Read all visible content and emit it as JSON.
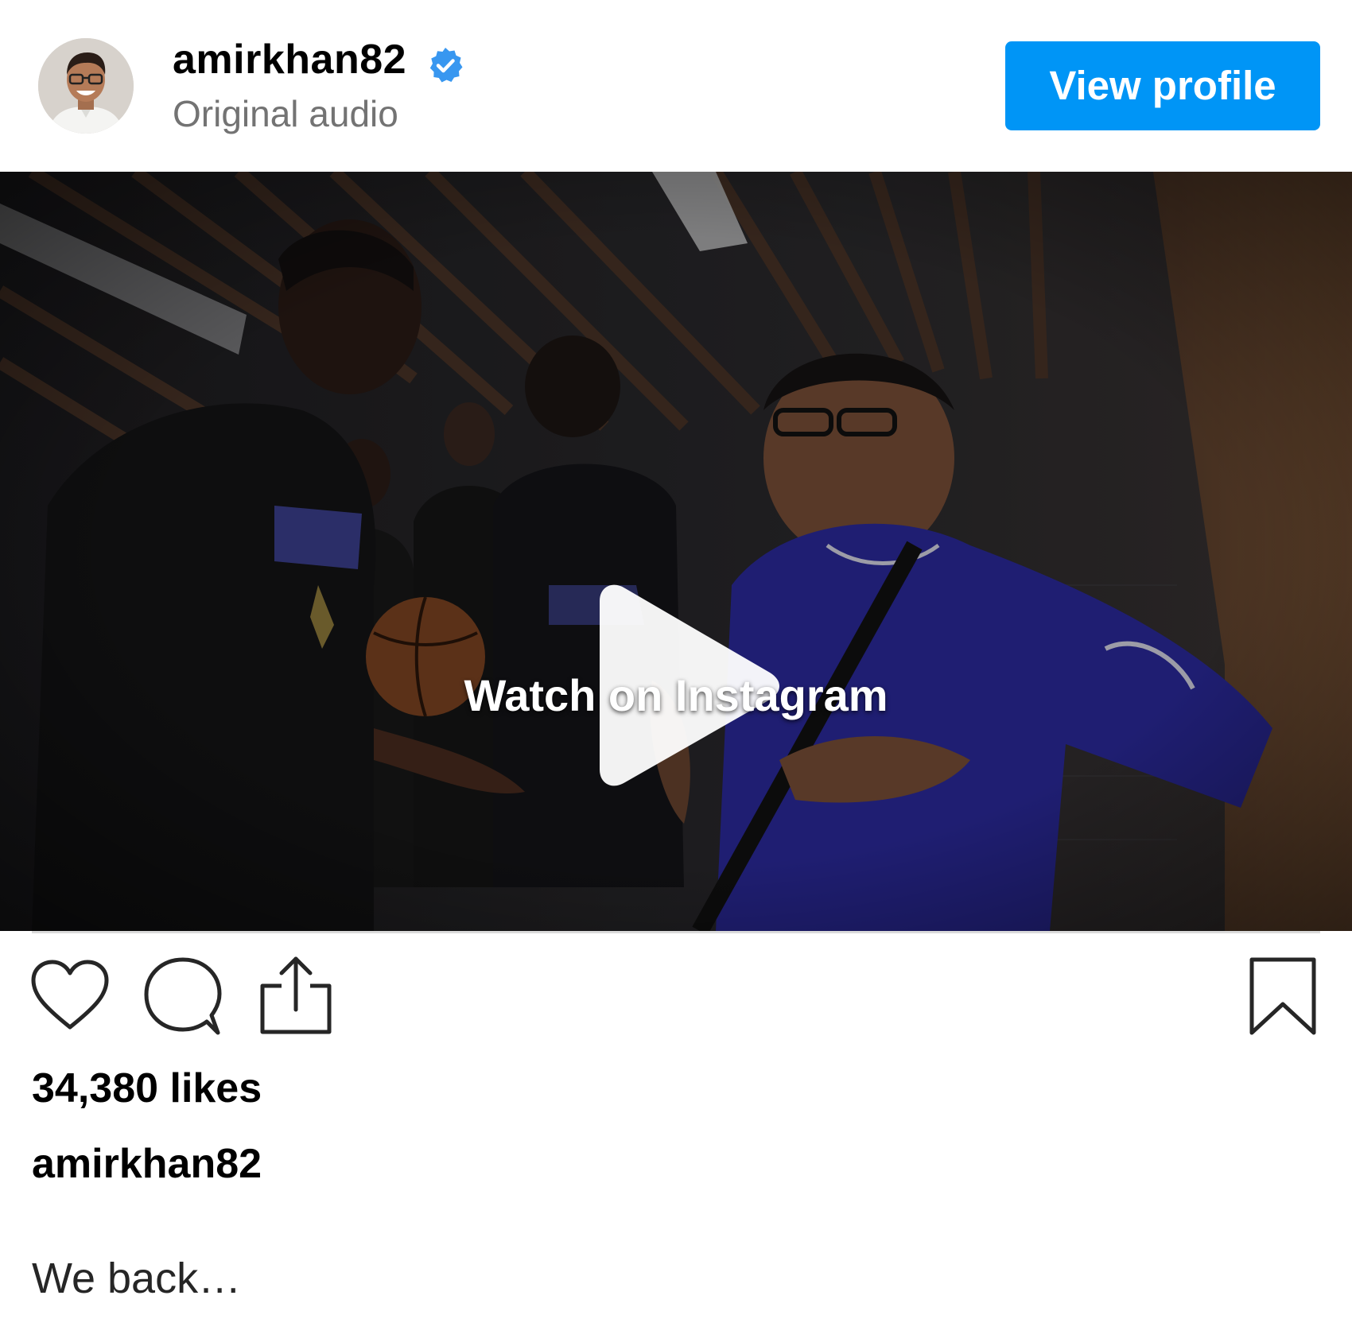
{
  "header": {
    "username": "amirkhan82",
    "verified": true,
    "audio_label": "Original audio",
    "view_profile_label": "View profile"
  },
  "video": {
    "overlay_label": "Watch on Instagram"
  },
  "actions": {
    "icons": [
      "heart-icon",
      "comment-icon",
      "share-icon",
      "bookmark-icon"
    ]
  },
  "post": {
    "likes": "34,380 likes",
    "caption_user": "amirkhan82",
    "caption_text": "We back…"
  },
  "colors": {
    "accent": "#0095f6",
    "verified": "#3897f0",
    "muted_text": "#737373"
  }
}
